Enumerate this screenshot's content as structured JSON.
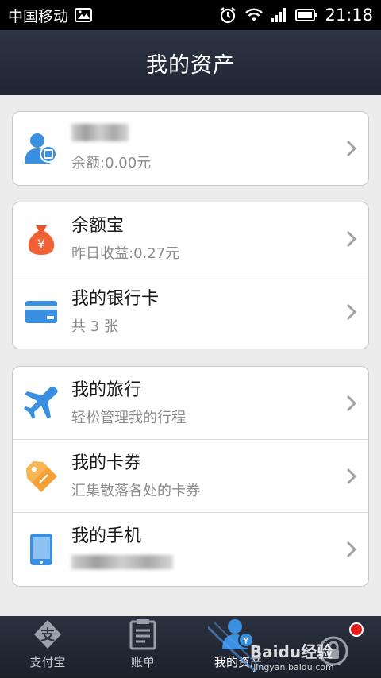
{
  "status_bar": {
    "carrier": "中国移动",
    "time": "21:18"
  },
  "header": {
    "title": "我的资产"
  },
  "account": {
    "balance": "余额:0.00元"
  },
  "assets": [
    {
      "title": "余额宝",
      "subtitle": "昨日收益:0.27元",
      "icon": "money-bag-icon"
    },
    {
      "title": "我的银行卡",
      "subtitle": "共 3 张",
      "icon": "bank-card-icon"
    }
  ],
  "services": [
    {
      "title": "我的旅行",
      "subtitle": "轻松管理我的行程",
      "icon": "airplane-icon"
    },
    {
      "title": "我的卡券",
      "subtitle": "汇集散落各处的卡券",
      "icon": "coupon-tag-icon"
    },
    {
      "title": "我的手机",
      "subtitle": "",
      "icon": "phone-icon"
    }
  ],
  "tabs": [
    {
      "label": "支付宝",
      "icon": "alipay-icon"
    },
    {
      "label": "账单",
      "icon": "bill-icon"
    },
    {
      "label": "我的资产",
      "icon": "my-assets-icon"
    },
    {
      "label": "",
      "icon": "security-icon"
    }
  ],
  "watermark": {
    "text1": "Baidu经验",
    "text2": "jingyan.baidu.com"
  },
  "colors": {
    "accent": "#3a8fe0",
    "header_bg": "#262c39",
    "page_bg": "#ececec"
  }
}
